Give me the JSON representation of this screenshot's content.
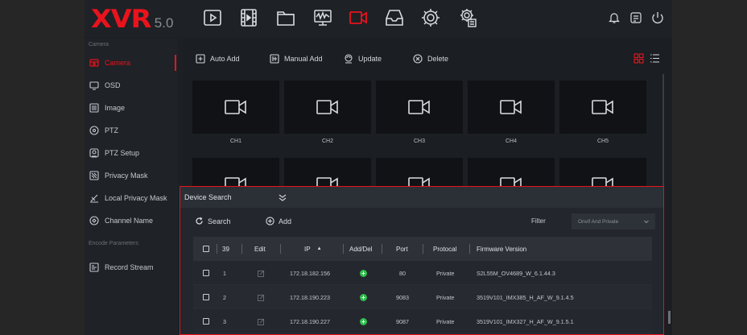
{
  "logo": {
    "brand": "XVR",
    "version": "5.0"
  },
  "topbar": {
    "icons": [
      "playback-icon",
      "video-clip-icon",
      "folder-icon",
      "analytics-monitor-icon",
      "camera-icon",
      "storage-icon",
      "settings-gear-icon",
      "system-settings-icon"
    ],
    "active": "camera-icon",
    "right_icons": [
      "bell-icon",
      "notes-icon",
      "power-icon"
    ]
  },
  "sidebar": {
    "section_camera": "Camera",
    "items": [
      {
        "label": "Camera",
        "icon": "camera-icon",
        "active": true
      },
      {
        "label": "OSD",
        "icon": "monitor-icon"
      },
      {
        "label": "Image",
        "icon": "image-icon"
      },
      {
        "label": "PTZ",
        "icon": "ptz-icon"
      },
      {
        "label": "PTZ Setup",
        "icon": "ptz-setup-icon"
      },
      {
        "label": "Privacy Mask",
        "icon": "privacy-mask-icon"
      },
      {
        "label": "Local Privacy Mask",
        "icon": "local-privacy-mask-icon"
      },
      {
        "label": "Channel Name",
        "icon": "channel-name-icon"
      }
    ],
    "section_encode": "Encode Parameters",
    "encode_items": [
      {
        "label": "Record Stream",
        "icon": "record-stream-icon"
      }
    ]
  },
  "toolbar": {
    "auto_add": "Auto Add",
    "manual_add": "Manual Add",
    "update": "Update",
    "delete": "Delete"
  },
  "channels": [
    "CH1",
    "CH2",
    "CH3",
    "CH4",
    "CH5"
  ],
  "device_search": {
    "title": "Device Search",
    "search_label": "Search",
    "add_label": "Add",
    "filter_label": "Filter",
    "filter_value": "Onvif And Private",
    "columns": {
      "count": "39",
      "edit": "Edit",
      "ip": "IP",
      "add_del": "Add/Del",
      "port": "Port",
      "protocol": "Protocal",
      "firmware": "Firmware Version"
    },
    "rows": [
      {
        "num": "1",
        "ip": "172.18.182.156",
        "port": "80",
        "protocol": "Private",
        "firmware": "S2L55M_OV4689_W_6.1.44.3"
      },
      {
        "num": "2",
        "ip": "172.18.190.223",
        "port": "9083",
        "protocol": "Private",
        "firmware": "3519V101_IMX385_H_AF_W_9.1.4.5"
      },
      {
        "num": "3",
        "ip": "172.18.190.227",
        "port": "9087",
        "protocol": "Private",
        "firmware": "3519V101_IMX327_H_AF_W_9.1.5.1"
      }
    ]
  },
  "colors": {
    "accent": "#e8131c",
    "add_green": "#2fbe4e"
  }
}
